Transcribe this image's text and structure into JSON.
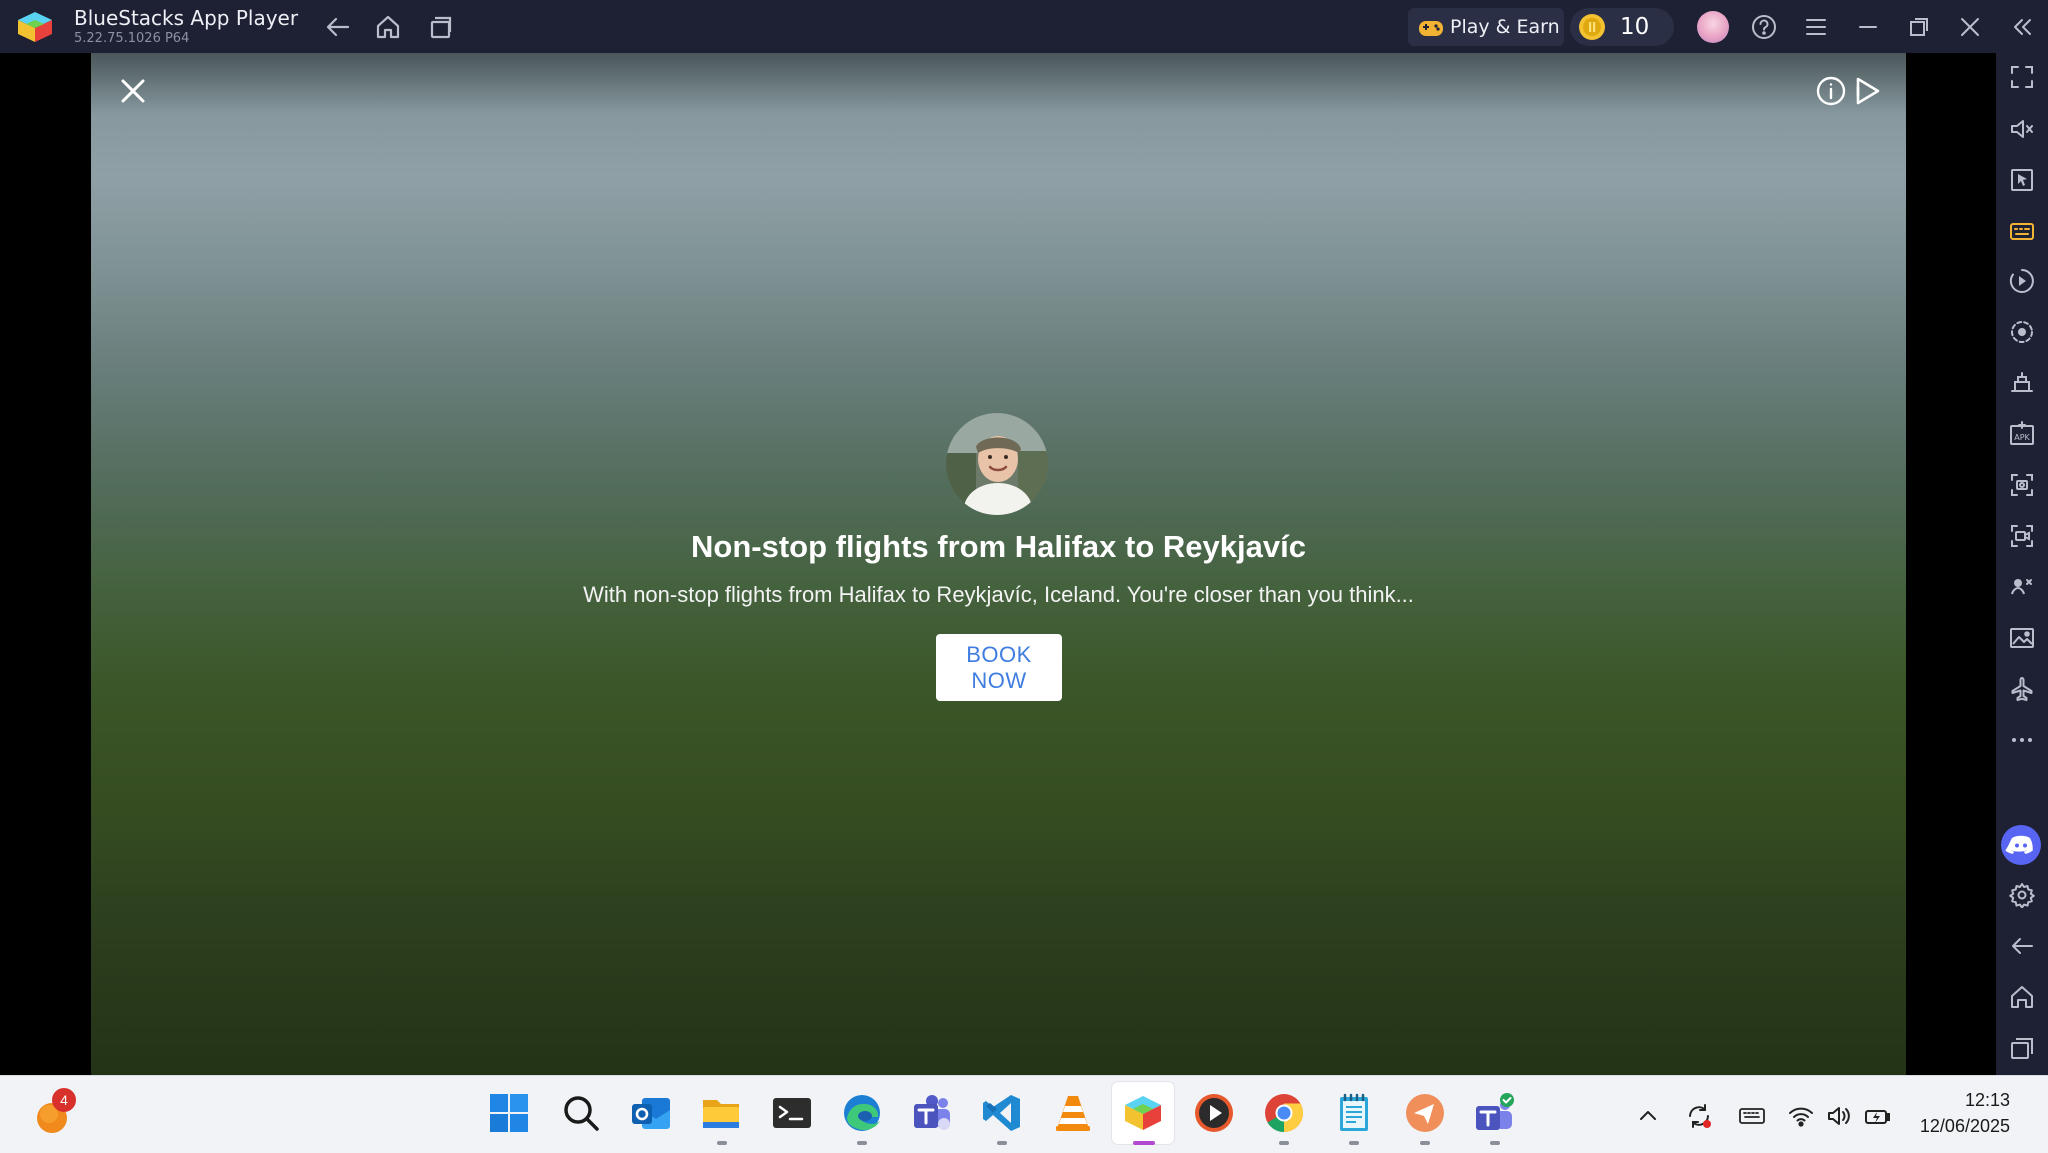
{
  "window": {
    "app_name": "BlueStacks App Player",
    "version": "5.22.75.1026  P64",
    "play_earn_label": "Play & Earn",
    "coin_count": "10"
  },
  "ad": {
    "title": "Non-stop flights from Halifax to Reykjavíc",
    "description": "With non-stop flights from Halifax to Reykjavíc, Iceland. You're closer than you think...",
    "cta_label": "BOOK NOW"
  },
  "taskbar": {
    "weather_badge": "4",
    "apps": [
      "start",
      "search",
      "outlook",
      "file-explorer",
      "terminal",
      "edge",
      "teams",
      "vscode",
      "vlc",
      "bluestacks",
      "media-player",
      "chrome",
      "notepad",
      "feedback-hub",
      "teams-work"
    ],
    "active_app": "bluestacks"
  },
  "clock": {
    "time": "12:13",
    "date": "12/06/2025"
  },
  "colors": {
    "title_bar": "#1d2133",
    "cta_text": "#3f7de0",
    "discord": "#5865f2"
  }
}
